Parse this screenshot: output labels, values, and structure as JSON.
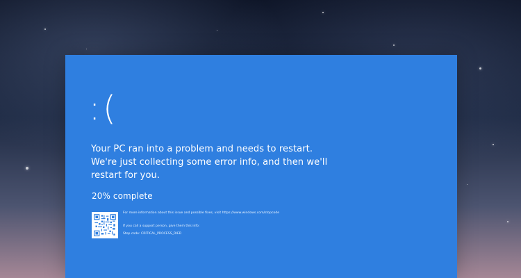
{
  "screen": {
    "background_colors": {
      "sky_top": "#0d1426",
      "sky_bottom": "#a58796",
      "bsod_blue": "#2f7fe0",
      "text": "#ffffff"
    },
    "error": {
      "face": ":(",
      "message": "Your PC ran into a problem and needs to restart. We're just collecting some error info, and then we'll restart for you.",
      "progress": "20% complete",
      "progress_percent": 20
    },
    "details": {
      "more_info": "For more information about this issue and possible fixes, visit https://www.windows.com/stopcode",
      "support_instruction": "If you call a support person, give them this info:",
      "stop_code": "Stop code: CRITICAL_PROCESS_DIED"
    },
    "icons": {
      "qr": "qr-code-icon"
    }
  }
}
